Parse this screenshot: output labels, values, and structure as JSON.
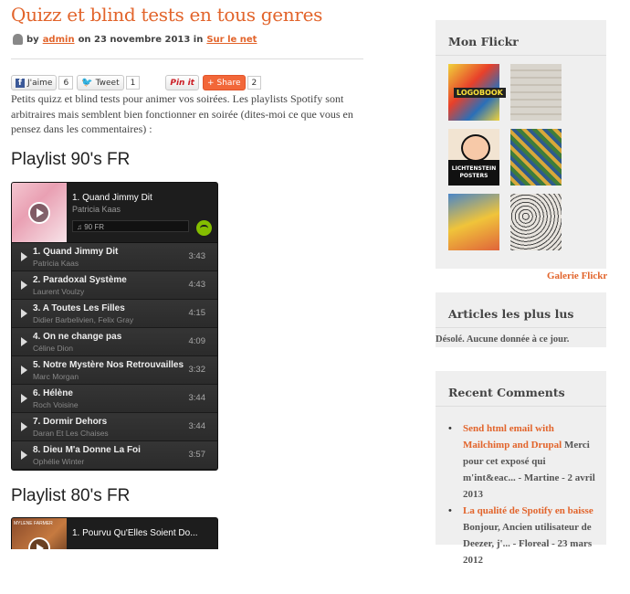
{
  "post": {
    "title": "Quizz et blind tests en tous genres",
    "meta_by": "by",
    "meta_author": "admin",
    "meta_on": "on 23 novembre 2013 in",
    "meta_category": "Sur le net",
    "intro": "Petits quizz et blind tests pour animer vos soirées. Les playlists Spotify sont arbitraires mais semblent bien fonctionner en soirée (dites-moi ce que vous en pensez dans les commentaires) :"
  },
  "social": {
    "like_label": "J'aime",
    "like_count": "6",
    "tweet_label": "Tweet",
    "tweet_count": "1",
    "pin_label": "Pin it",
    "share_label": "Share",
    "share_count": "2"
  },
  "playlist1": {
    "heading": "Playlist 90's FR",
    "header_track": "1. Quand Jimmy Dit",
    "header_artist": "Patricia Kaas",
    "playlist_name": "90 FR",
    "tracks": [
      {
        "name": "1. Quand Jimmy Dit",
        "artist": "Patricia Kaas",
        "time": "3:43"
      },
      {
        "name": "2. Paradoxal Système",
        "artist": "Laurent Voulzy",
        "time": "4:43"
      },
      {
        "name": "3. A Toutes Les Filles",
        "artist": "Didier Barbelivien, Felix Gray",
        "time": "4:15"
      },
      {
        "name": "4. On ne change pas",
        "artist": "Céline Dion",
        "time": "4:09"
      },
      {
        "name": "5. Notre Mystère Nos Retrouvailles",
        "artist": "Marc Morgan",
        "time": "3:32"
      },
      {
        "name": "6. Hélène",
        "artist": "Roch Voisine",
        "time": "3:44"
      },
      {
        "name": "7. Dormir Dehors",
        "artist": "Daran Et Les Chaises",
        "time": "3:44"
      },
      {
        "name": "8. Dieu M'a Donne La Foi",
        "artist": "Ophélie Winter",
        "time": "3:57"
      }
    ]
  },
  "playlist2": {
    "heading": "Playlist 80's FR",
    "header_track": "1. Pourvu Qu'Elles Soient Do...",
    "cover_text": "MYLENE FARMER"
  },
  "sidebar": {
    "flickr_title": "Mon Flickr",
    "flickr_link": "Galerie Flickr",
    "popular_title": "Articles les plus lus",
    "popular_empty": "Désolé. Aucune donnée à ce jour.",
    "recent_title": "Recent Comments",
    "comments": [
      {
        "link": "Send html email with Mailchimp and Drupal",
        "text": " Merci pour cet exposé qui m'int&eac... - Martine - 2 avril 2013"
      },
      {
        "link": "La qualité de Spotify en baisse",
        "text": " Bonjour, Ancien utilisateur de Deezer, j'... - Floreal - 23 mars 2012"
      }
    ]
  },
  "flickr_thumbs": [
    "LOGOBOOK",
    "",
    "LICHTENSTEIN POSTERS",
    "",
    "",
    ""
  ],
  "colors": {
    "accent": "#e2642b",
    "spotify": "#84bd00"
  }
}
